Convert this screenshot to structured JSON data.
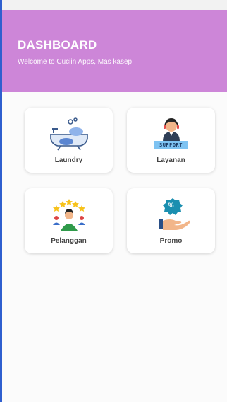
{
  "header": {
    "title": "DASHBOARD",
    "subtitle": "Welcome to Cuciin Apps, Mas kasep"
  },
  "menu": [
    {
      "label": "Laundry",
      "icon": "washing-basin-icon"
    },
    {
      "label": "Layanan",
      "icon": "support-agent-icon",
      "badge": "SUPPORT"
    },
    {
      "label": "Pelanggan",
      "icon": "customer-rating-icon"
    },
    {
      "label": "Promo",
      "icon": "promo-discount-icon",
      "badge": "%"
    }
  ],
  "colors": {
    "header": "#cd86d8",
    "frame_border": "#2f5fcf"
  }
}
